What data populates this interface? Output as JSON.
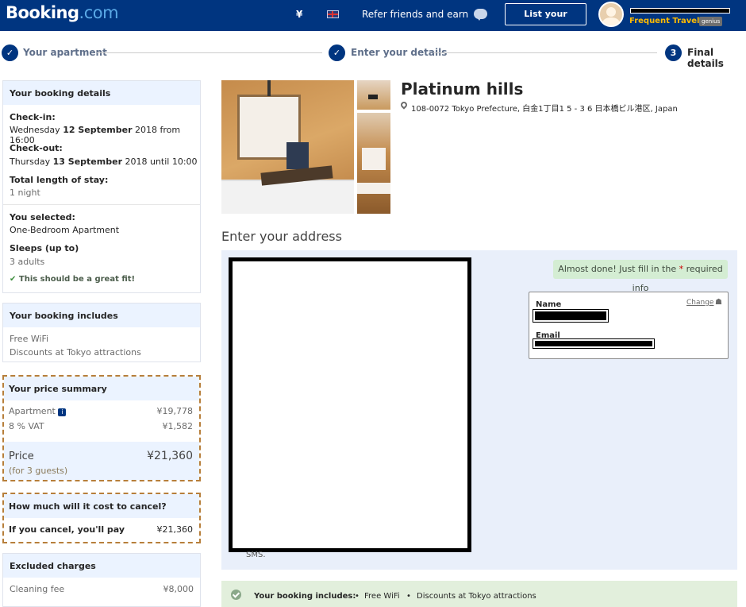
{
  "header": {
    "logo_main": "Booking",
    "logo_domain": ".com",
    "currency": "¥",
    "refer": "Refer friends and earn",
    "list_property": "List your property",
    "traveller_level": "Frequent Traveller",
    "genius_badge": "genius"
  },
  "progress": {
    "step1": "Your apartment",
    "step2": "Enter your details",
    "step3_number": "3",
    "step3": "Final details"
  },
  "booking_details": {
    "title": "Your booking details",
    "checkin_label": "Check-in:",
    "checkin_day": "Wednesday",
    "checkin_date": "12 September",
    "checkin_rest": "2018 from 16:00",
    "checkout_label": "Check-out:",
    "checkout_day": "Thursday",
    "checkout_date": "13 September",
    "checkout_rest": "2018 until 10:00",
    "length_label": "Total length of stay:",
    "length_value": "1 night",
    "selected_label": "You selected:",
    "selected_value": "One-Bedroom Apartment",
    "sleeps_label": "Sleeps (up to)",
    "sleeps_value": "3 adults",
    "fit": "This should be a great fit!"
  },
  "includes": {
    "title": "Your booking includes",
    "items": [
      "Free WiFi",
      "Discounts at Tokyo attractions"
    ]
  },
  "price_summary": {
    "title": "Your price summary",
    "apartment_label": "Apartment",
    "apartment_value": "¥19,778",
    "vat_label": "8 % VAT",
    "vat_value": "¥1,582",
    "price_label": "Price",
    "price_value": "¥21,360",
    "guests": "(for 3 guests)"
  },
  "cancel": {
    "title": "How much will it cost to cancel?",
    "label": "If you cancel, you'll pay",
    "value": "¥21,360"
  },
  "excluded": {
    "title": "Excluded charges",
    "label": "Cleaning fee",
    "value": "¥8,000"
  },
  "property": {
    "name": "Platinum hills",
    "address": "108-0072 Tokyo Prefecture, 白金1丁目1 5 - 3 6 日本橋ビル港区, Japan"
  },
  "form": {
    "section_title": "Enter your address",
    "almost_prefix": "Almost done! Just fill in the",
    "almost_star": "*",
    "almost_suffix": "required info",
    "name_label": "Name",
    "email_label": "Email",
    "change": "Change",
    "sms": "SMS."
  },
  "banner": {
    "title": "Your booking includes:",
    "item1": "Free WiFi",
    "item2": "Discounts at Tokyo attractions"
  },
  "colors": {
    "brand": "#003580",
    "genius": "#febb02",
    "panel_head": "#ebf3ff",
    "dashed": "#b77f3b",
    "form_bg": "#e9effa",
    "success_bg": "#d4edd3"
  }
}
